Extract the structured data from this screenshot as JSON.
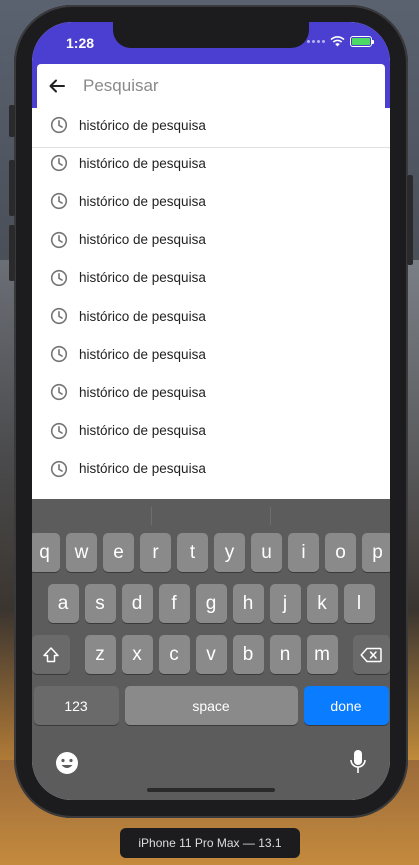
{
  "status_bar": {
    "time": "1:28"
  },
  "search": {
    "placeholder": "Pesquisar",
    "value": ""
  },
  "history": {
    "items": [
      {
        "label": "histórico de pesquisa"
      },
      {
        "label": "histórico de pesquisa"
      },
      {
        "label": "histórico de pesquisa"
      },
      {
        "label": "histórico de pesquisa"
      },
      {
        "label": "histórico de pesquisa"
      },
      {
        "label": "histórico de pesquisa"
      },
      {
        "label": "histórico de pesquisa"
      },
      {
        "label": "histórico de pesquisa"
      },
      {
        "label": "histórico de pesquisa"
      },
      {
        "label": "histórico de pesquisa"
      }
    ]
  },
  "keyboard": {
    "row1": [
      "q",
      "w",
      "e",
      "r",
      "t",
      "y",
      "u",
      "i",
      "o",
      "p"
    ],
    "row2": [
      "a",
      "s",
      "d",
      "f",
      "g",
      "h",
      "j",
      "k",
      "l"
    ],
    "row3": [
      "z",
      "x",
      "c",
      "v",
      "b",
      "n",
      "m"
    ],
    "num_label": "123",
    "space_label": "space",
    "done_label": "done"
  },
  "device": {
    "label": "iPhone 11 Pro Max — 13.1"
  },
  "colors": {
    "accent": "#4a3fd0",
    "done_key": "#0a7cff",
    "battery": "#4cd964"
  },
  "icons": {
    "back": "arrow-left-icon",
    "history": "clock-icon",
    "shift": "shift-icon",
    "delete": "backspace-icon",
    "emoji": "emoji-icon",
    "mic": "microphone-icon"
  }
}
